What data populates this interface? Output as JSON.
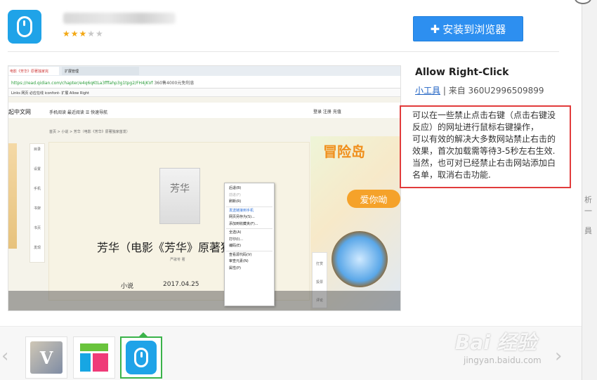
{
  "header": {
    "rating_filled": "★★★",
    "rating_empty": "★★",
    "install_label": "安装到浏览器"
  },
  "extension": {
    "title": "Allow Right-Click",
    "category_link": "小工具",
    "source": " | 来自 360U2996509899",
    "description": [
      "可以在一些禁止点击右键（点击右键没反应）的网址进行鼠标右键操作，",
      "可以有效的解决大多数网站禁止右击的效果，首次加载需等待3-5秒左右生效.",
      "当然，也可对已经禁止右击网站添加白名单，取消右击功能."
    ]
  },
  "screenshot": {
    "tab1": "电影《芳华》原著独家完",
    "tab2": "扩展管理",
    "url": "https://read.qidian.com/chapter/e4q6qKtLa3fffahp3g1tpg2/FH4jKVf",
    "url_hint": "360售4000元免利息",
    "bookmarks": "Links  网页  必应在线  iconfont-  扩展  Allow Right",
    "site_logo": "起中文网",
    "site_nav": "手机阅读   最近阅读   ☰ 快速导航",
    "site_right": "登录   注册   充值",
    "breadcrumb": "首页 > 小说 > 芳华（电影《芳华》原著独家首发）",
    "side_items": [
      "目录",
      "设置",
      "手机",
      "书架",
      "书页",
      "发现"
    ],
    "cover_text": "芳华",
    "book_title": "芳华（电影《芳华》原著独",
    "author": "严歌苓 著",
    "meta_left": "小说",
    "meta_date": "2017.04.25",
    "art_logo": "冒险岛",
    "art_cta": "爱你呦",
    "right_side": [
      "打赏",
      "投票",
      "评论"
    ],
    "context_menu": [
      "后退(B)",
      "前进(F)",
      "刷新(R)",
      "发送链接到手机",
      "网页另存为(S)...",
      "添加到收藏夹(F)...",
      "全选(A)",
      "打印(I)...",
      "编码(E)",
      "查看源代码(V)",
      "审查元素(N)",
      "属性(P)"
    ]
  },
  "strip": {
    "t1": "析一",
    "t2": "員"
  },
  "thumbs": {
    "t1_glyph": "V"
  },
  "watermark": {
    "main": "Bai 经验",
    "sub": "jingyan.baidu.com"
  }
}
